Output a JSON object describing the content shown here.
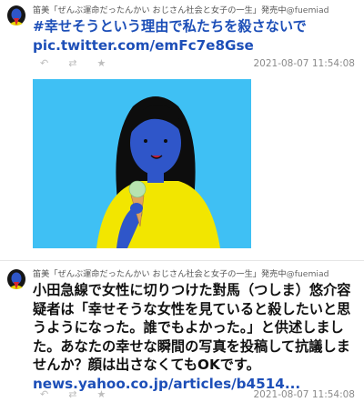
{
  "tweets": [
    {
      "author": "笛美「ぜんぶ運命だったんかい おじさん社会と女子の一生」発売中",
      "handle": "@fuemiad",
      "hashtag": "#幸せそうという理由で私たちを殺さないで",
      "link": "pic.twitter.com/emFc7e8Gse",
      "timestamp": "2021-08-07 11:54:08",
      "has_media": true
    },
    {
      "author": "笛美「ぜんぶ運命だったんかい おじさん社会と女子の一生」発売中",
      "handle": "@fuemiad",
      "text": "小田急線で女性に切りつけた對馬（つしま）悠介容疑者は「幸せそうな女性を見ていると殺したいと思うようになった。誰でもよかった。」と供述しました。あなたの幸せな瞬間の写真を投稿して抗議しませんか？顔は出さなくてもOKです。",
      "link": "news.yahoo.co.jp/articles/b4514...",
      "timestamp": "2021-08-07 11:54:08"
    }
  ],
  "icons": {
    "reply": "reply-icon",
    "retweet": "retweet-icon",
    "like": "heart-icon"
  },
  "colors": {
    "link": "#1d4fb8",
    "media_bg": "#3fc0f4",
    "shirt": "#f2e600",
    "skin": "#2f56c9"
  }
}
